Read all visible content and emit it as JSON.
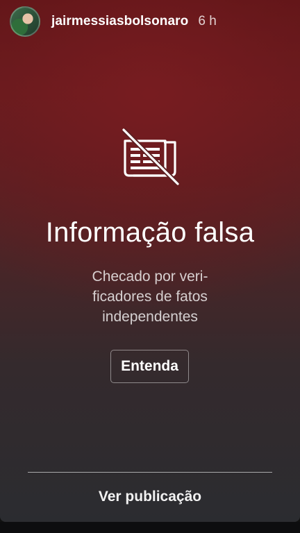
{
  "header": {
    "username": "jairmessiasbolsonaro",
    "time": "6 h"
  },
  "warning": {
    "icon": "newspaper-crossed-icon",
    "title": "Informação falsa",
    "subtitle_lines": [
      "Checado por veri-",
      "ficadores de fatos",
      "independentes"
    ],
    "learn_button": "Entenda"
  },
  "footer": {
    "see_post": "Ver publicação"
  },
  "colors": {
    "top_red": "#6a1c1f",
    "bottom_gray": "#2b2c30",
    "text": "#ffffff"
  }
}
